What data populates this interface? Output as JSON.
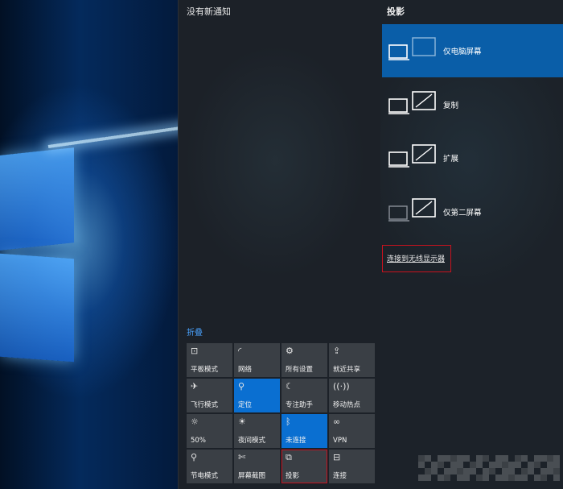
{
  "action_center": {
    "notification_title": "没有新通知",
    "collapse_label": "折叠",
    "tiles": [
      {
        "label": "平板模式",
        "icon": "tablet-mode-icon",
        "glyph": "⊡",
        "active": false
      },
      {
        "label": "网络",
        "icon": "network-icon",
        "glyph": "◜",
        "active": false
      },
      {
        "label": "所有设置",
        "icon": "settings-gear-icon",
        "glyph": "⚙",
        "active": false
      },
      {
        "label": "就近共享",
        "icon": "nearby-share-icon",
        "glyph": "⇪",
        "active": false
      },
      {
        "label": "飞行模式",
        "icon": "airplane-icon",
        "glyph": "✈",
        "active": false
      },
      {
        "label": "定位",
        "icon": "location-icon",
        "glyph": "⚲",
        "active": true
      },
      {
        "label": "专注助手",
        "icon": "moon-icon",
        "glyph": "☾",
        "active": false
      },
      {
        "label": "移动热点",
        "icon": "hotspot-icon",
        "glyph": "((·))",
        "active": false
      },
      {
        "label": "50%",
        "icon": "brightness-icon",
        "glyph": "☼",
        "active": false
      },
      {
        "label": "夜间模式",
        "icon": "night-light-icon",
        "glyph": "☀",
        "active": false
      },
      {
        "label": "未连接",
        "icon": "bluetooth-icon",
        "glyph": "ᛒ",
        "active": true
      },
      {
        "label": "VPN",
        "icon": "vpn-icon",
        "glyph": "∞",
        "active": false
      },
      {
        "label": "节电模式",
        "icon": "battery-saver-icon",
        "glyph": "⚲",
        "active": false
      },
      {
        "label": "屏幕截图",
        "icon": "screen-snip-icon",
        "glyph": "✄",
        "active": false
      },
      {
        "label": "投影",
        "icon": "project-icon",
        "glyph": "⧉",
        "active": false
      },
      {
        "label": "连接",
        "icon": "connect-icon",
        "glyph": "⊟",
        "active": false
      }
    ]
  },
  "project_panel": {
    "title": "投影",
    "modes": [
      {
        "label": "仅电脑屏幕",
        "selected": true,
        "icon": "pc-screen-only-icon"
      },
      {
        "label": "复制",
        "selected": false,
        "icon": "duplicate-icon"
      },
      {
        "label": "扩展",
        "selected": false,
        "icon": "extend-icon"
      },
      {
        "label": "仅第二屏幕",
        "selected": false,
        "icon": "second-screen-only-icon"
      }
    ],
    "wireless_link": "连接到无线显示器"
  },
  "colors": {
    "accent": "#0a6fd1",
    "selected_mode": "#0a5ea8",
    "highlight_box": "#c8121e",
    "link": "#4aa3ff"
  }
}
